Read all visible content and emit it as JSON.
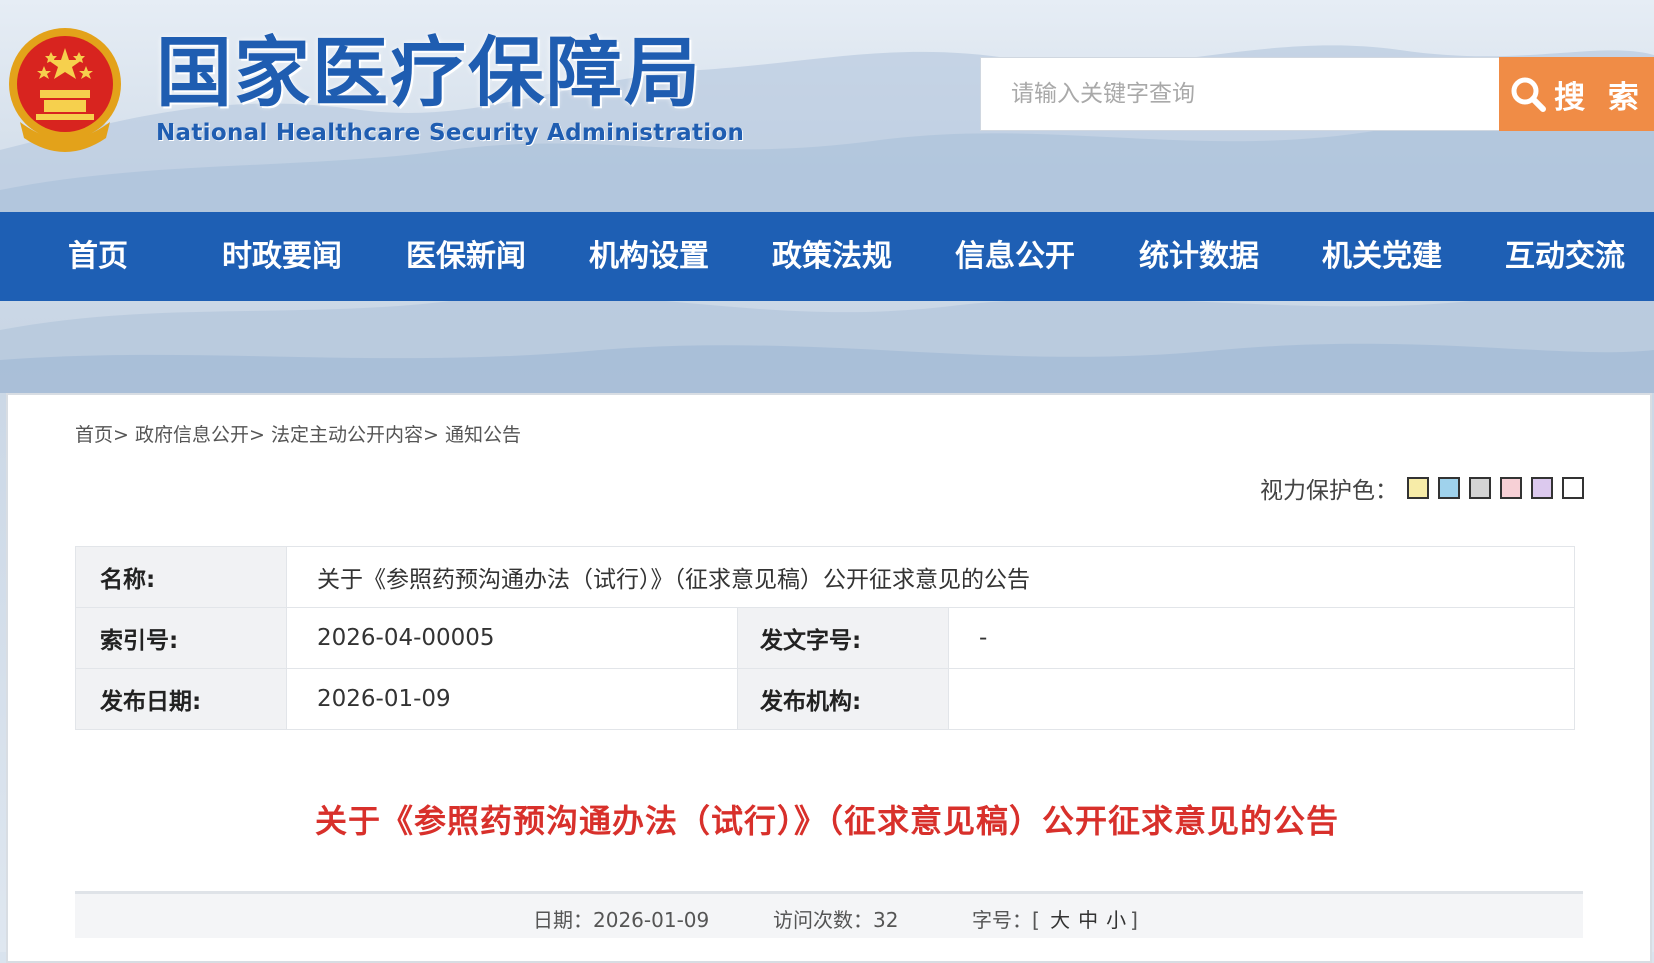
{
  "header": {
    "title": "国家医疗保障局",
    "subtitle": "National Healthcare Security Administration",
    "emblem_icon": "national-emblem-icon"
  },
  "search": {
    "placeholder": "请输入关键字查询",
    "button_label": "搜 索",
    "button_color": "#f08c46"
  },
  "nav": {
    "color": "#1e5fb4",
    "items": [
      {
        "label": "首页"
      },
      {
        "label": "时政要闻"
      },
      {
        "label": "医保新闻"
      },
      {
        "label": "机构设置"
      },
      {
        "label": "政策法规"
      },
      {
        "label": "信息公开"
      },
      {
        "label": "统计数据"
      },
      {
        "label": "机关党建"
      },
      {
        "label": "互动交流"
      }
    ]
  },
  "breadcrumb": {
    "items": [
      "首页",
      "政府信息公开",
      "法定主动公开内容",
      "通知公告"
    ],
    "separator": ">"
  },
  "vision": {
    "label": "视力保护色：",
    "swatches": [
      "#f7eca8",
      "#9fd2ec",
      "#d4d4d4",
      "#f7d0d6",
      "#dcc9ee",
      "#ffffff"
    ]
  },
  "meta": {
    "name_label": "名称:",
    "name_value": "关于《参照药预沟通办法（试行）》（征求意见稿）公开征求意见的公告",
    "index_label": "索引号:",
    "index_value": "2026-04-00005",
    "docno_label": "发文字号:",
    "docno_value": "-",
    "date_label": "发布日期:",
    "date_value": "2026-01-09",
    "org_label": "发布机构:",
    "org_value": ""
  },
  "article": {
    "title": "关于《参照药预沟通办法（试行）》（征求意见稿）公开征求意见的公告",
    "title_color": "#d8302b",
    "date_label": "日期：",
    "date_value": "2026-01-09",
    "visits_label": "访问次数：",
    "visits_value": "32",
    "fontsize_label": "字号：[",
    "fontsize_large": "大",
    "fontsize_medium": "中",
    "fontsize_small": "小",
    "fontsize_end": "]"
  }
}
